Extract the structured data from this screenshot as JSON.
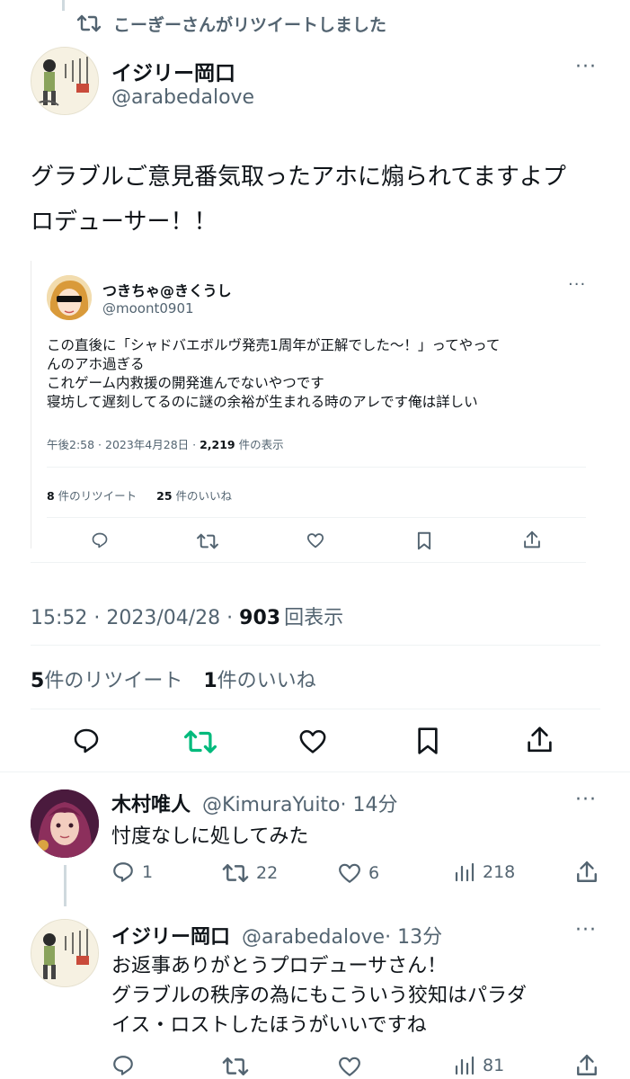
{
  "retweet_banner": {
    "text": "こーぎーさんがリツイートしました"
  },
  "main_tweet": {
    "display_name": "イジリー岡口",
    "handle": "@arabedalove",
    "body_line1": "グラブルご意見番気取ったアホに煽られてますよプ",
    "body_line2": "ロデューサー！！",
    "timestamp": "15:52 · 2023/04/28 · ",
    "views_count": "903",
    "views_label": "回表示",
    "retweets_count": "5",
    "retweets_label": "件のリツイート",
    "likes_count": "1",
    "likes_label": "件のいいね"
  },
  "quoted_tweet": {
    "display_name": "つきちゃ@きくうし",
    "handle": "@moont0901",
    "line1": "この直後に「シャドバエボルヴ発売1周年が正解でした～！」ってやって",
    "line2": "んのアホ過ぎる",
    "line3": "これゲーム内救援の開発進んでないやつです",
    "line4": "寝坊して遅刻してるのに謎の余裕が生まれる時のアレです俺は詳しい",
    "meta_prefix": "午後2:58 · 2023年4月28日 · ",
    "views_count": "2,219",
    "views_label": " 件の表示",
    "retweets_count": "8",
    "retweets_label": " 件のリツイート",
    "likes_count": "25",
    "likes_label": " 件のいいね"
  },
  "reply1": {
    "display_name": "木村唯人",
    "handle": "@KimuraYuito",
    "time": "· 14分",
    "body": "忖度なしに処してみた",
    "replies": "1",
    "retweets": "22",
    "likes": "6",
    "views": "218"
  },
  "reply2": {
    "display_name": "イジリー岡口",
    "handle": "@arabedalove",
    "time": "· 13分",
    "line1": "お返事ありがとうプロデューサさん！",
    "line2": "グラブルの秩序の為にもこういう狡知はパラダ",
    "line3": "イス・ロストしたほうがいいですね",
    "views": "81"
  },
  "colors": {
    "retweet_active": "#00ba7c",
    "text": "#0f1419",
    "muted": "#536471"
  }
}
